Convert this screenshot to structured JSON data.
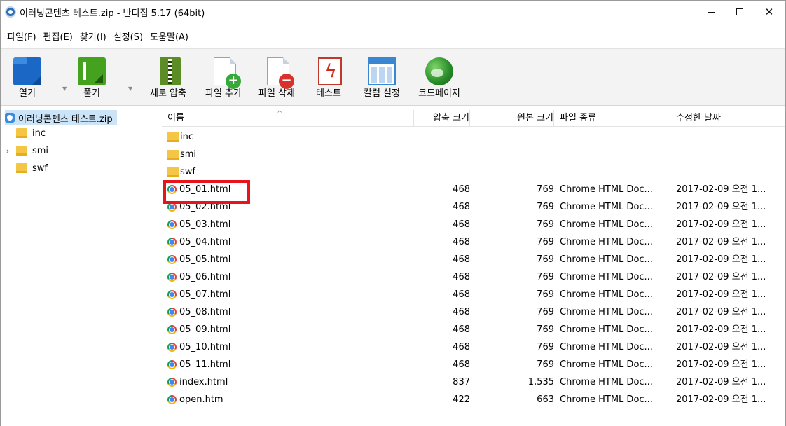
{
  "window": {
    "title": "이러닝콘텐츠 테스트.zip - 반디집 5.17 (64bit)",
    "close_glyph": "✕"
  },
  "menu": [
    "파일(F)",
    "편집(E)",
    "찾기(I)",
    "설정(S)",
    "도움말(A)"
  ],
  "toolbar": {
    "open": "열기",
    "extract": "풀기",
    "new_archive": "새로 압축",
    "add_files": "파일 추가",
    "delete_files": "파일 삭제",
    "test": "테스트",
    "columns": "칼럼 설정",
    "codepage": "코드페이지",
    "add_badge": "+",
    "delete_badge": "−",
    "test_bolt": "ϟ"
  },
  "tree": {
    "root": "이러닝콘텐츠 테스트.zip",
    "items": [
      {
        "label": "inc",
        "expander": ""
      },
      {
        "label": "smi",
        "expander": "›"
      },
      {
        "label": "swf",
        "expander": ""
      }
    ]
  },
  "list": {
    "columns": {
      "name": "이름",
      "compressed": "압축 크기",
      "original": "원본 크기",
      "type": "파일 종류",
      "modified": "수정한 날짜"
    },
    "folders": [
      "inc",
      "smi",
      "swf"
    ],
    "files": [
      {
        "name": "05_01.html",
        "compressed": "468",
        "original": "769",
        "type": "Chrome HTML Doc...",
        "modified": "2017-02-09 오전 1..."
      },
      {
        "name": "05_02.html",
        "compressed": "468",
        "original": "769",
        "type": "Chrome HTML Doc...",
        "modified": "2017-02-09 오전 1..."
      },
      {
        "name": "05_03.html",
        "compressed": "468",
        "original": "769",
        "type": "Chrome HTML Doc...",
        "modified": "2017-02-09 오전 1..."
      },
      {
        "name": "05_04.html",
        "compressed": "468",
        "original": "769",
        "type": "Chrome HTML Doc...",
        "modified": "2017-02-09 오전 1..."
      },
      {
        "name": "05_05.html",
        "compressed": "468",
        "original": "769",
        "type": "Chrome HTML Doc...",
        "modified": "2017-02-09 오전 1..."
      },
      {
        "name": "05_06.html",
        "compressed": "468",
        "original": "769",
        "type": "Chrome HTML Doc...",
        "modified": "2017-02-09 오전 1..."
      },
      {
        "name": "05_07.html",
        "compressed": "468",
        "original": "769",
        "type": "Chrome HTML Doc...",
        "modified": "2017-02-09 오전 1..."
      },
      {
        "name": "05_08.html",
        "compressed": "468",
        "original": "769",
        "type": "Chrome HTML Doc...",
        "modified": "2017-02-09 오전 1..."
      },
      {
        "name": "05_09.html",
        "compressed": "468",
        "original": "769",
        "type": "Chrome HTML Doc...",
        "modified": "2017-02-09 오전 1..."
      },
      {
        "name": "05_10.html",
        "compressed": "468",
        "original": "769",
        "type": "Chrome HTML Doc...",
        "modified": "2017-02-09 오전 1..."
      },
      {
        "name": "05_11.html",
        "compressed": "468",
        "original": "769",
        "type": "Chrome HTML Doc...",
        "modified": "2017-02-09 오전 1..."
      },
      {
        "name": "index.html",
        "compressed": "837",
        "original": "1,535",
        "type": "Chrome HTML Doc...",
        "modified": "2017-02-09 오전 1..."
      },
      {
        "name": "open.htm",
        "compressed": "422",
        "original": "663",
        "type": "Chrome HTML Doc...",
        "modified": "2017-02-09 오전 1..."
      }
    ],
    "highlighted_file": "05_01.html",
    "highlight_color": "#e8141b"
  }
}
